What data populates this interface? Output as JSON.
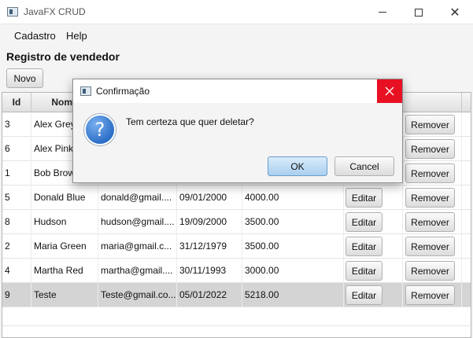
{
  "window": {
    "title": "JavaFX CRUD"
  },
  "menu": {
    "items": [
      "Cadastro",
      "Help"
    ]
  },
  "page": {
    "heading": "Registro de vendedor",
    "new_button": "Novo"
  },
  "table": {
    "headers": [
      "Id",
      "Nome",
      "",
      "",
      "",
      "",
      ""
    ],
    "edit_label": "Editar",
    "remove_label": "Remover",
    "rows": [
      {
        "id": "3",
        "nome": "Alex Grey",
        "email": "",
        "data": "",
        "salario": ""
      },
      {
        "id": "6",
        "nome": "Alex Pink",
        "email": "",
        "data": "",
        "salario": ""
      },
      {
        "id": "1",
        "nome": "Bob Brown",
        "email": "",
        "data": "",
        "salario": ""
      },
      {
        "id": "5",
        "nome": "Donald Blue",
        "email": "donald@gmail....",
        "data": "09/01/2000",
        "salario": "4000.00"
      },
      {
        "id": "8",
        "nome": "Hudson",
        "email": "hudson@gmail....",
        "data": "19/09/2000",
        "salario": "3500.00"
      },
      {
        "id": "2",
        "nome": "Maria Green",
        "email": "maria@gmail.c...",
        "data": "31/12/1979",
        "salario": "3500.00"
      },
      {
        "id": "4",
        "nome": "Martha Red",
        "email": "martha@gmail....",
        "data": "30/11/1993",
        "salario": "3000.00"
      },
      {
        "id": "9",
        "nome": "Teste",
        "email": "Teste@gmail.co...",
        "data": "05/01/2022",
        "salario": "5218.00"
      }
    ],
    "selected_index": 7
  },
  "dialog": {
    "title": "Confirmação",
    "message": "Tem certeza que quer deletar?",
    "ok_label": "OK",
    "cancel_label": "Cancel",
    "icon": "question-icon",
    "close_color": "#e81123"
  }
}
